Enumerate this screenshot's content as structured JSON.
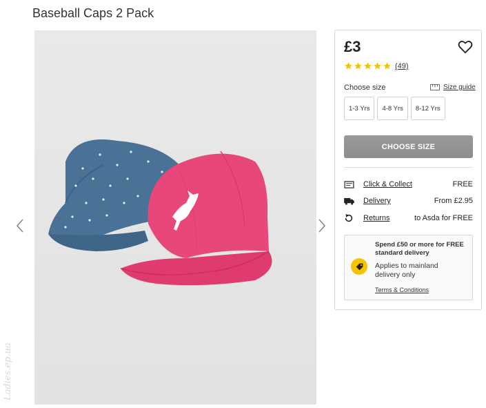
{
  "product": {
    "title": "Baseball Caps 2 Pack"
  },
  "pricing": {
    "price": "£3",
    "rating_stars": 5,
    "review_count": "(49)"
  },
  "size": {
    "label": "Choose size",
    "guide_label": "Size guide",
    "options": [
      "1-3 Yrs",
      "4-8 Yrs",
      "8-12 Yrs"
    ]
  },
  "cta": {
    "label": "CHOOSE SIZE"
  },
  "delivery": [
    {
      "icon": "click-collect-icon",
      "label": "Click & Collect",
      "value": "FREE"
    },
    {
      "icon": "delivery-truck-icon",
      "label": "Delivery",
      "value": "From £2.95"
    },
    {
      "icon": "returns-icon",
      "label": "Returns",
      "value": "to Asda for FREE"
    }
  ],
  "promo": {
    "headline": "Spend £50 or more for FREE standard delivery",
    "body": "Applies to mainland delivery only",
    "terms": "Terms & Conditions",
    "icon": "price-tag-icon"
  },
  "colors": {
    "accent_yellow": "#f5c400",
    "cta_gray": "#929292",
    "cap_pink": "#e8477a",
    "cap_denim": "#4a7296"
  },
  "watermark": "Ladies.ep.ua"
}
